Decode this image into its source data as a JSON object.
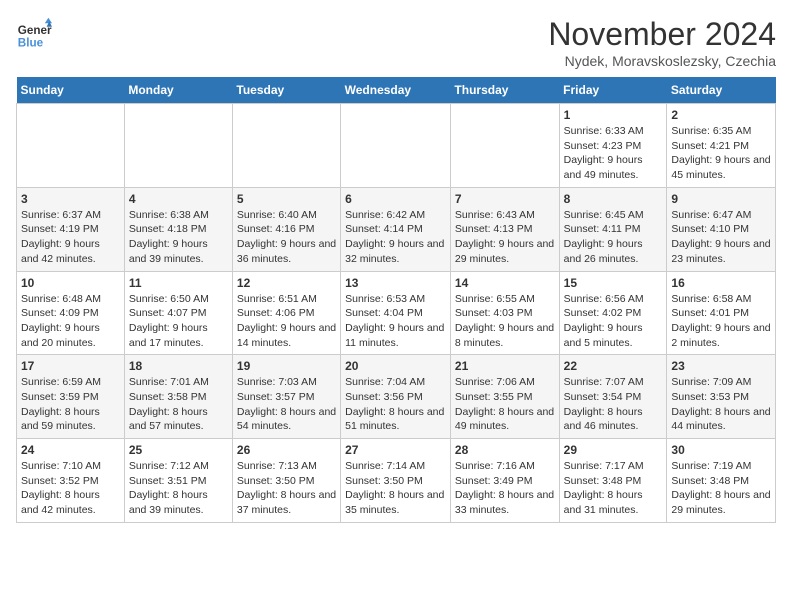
{
  "logo": {
    "line1": "General",
    "line2": "Blue"
  },
  "title": "November 2024",
  "subtitle": "Nydek, Moravskoslezsky, Czechia",
  "days_of_week": [
    "Sunday",
    "Monday",
    "Tuesday",
    "Wednesday",
    "Thursday",
    "Friday",
    "Saturday"
  ],
  "weeks": [
    [
      {
        "day": "",
        "info": ""
      },
      {
        "day": "",
        "info": ""
      },
      {
        "day": "",
        "info": ""
      },
      {
        "day": "",
        "info": ""
      },
      {
        "day": "",
        "info": ""
      },
      {
        "day": "1",
        "info": "Sunrise: 6:33 AM\nSunset: 4:23 PM\nDaylight: 9 hours and 49 minutes."
      },
      {
        "day": "2",
        "info": "Sunrise: 6:35 AM\nSunset: 4:21 PM\nDaylight: 9 hours and 45 minutes."
      }
    ],
    [
      {
        "day": "3",
        "info": "Sunrise: 6:37 AM\nSunset: 4:19 PM\nDaylight: 9 hours and 42 minutes."
      },
      {
        "day": "4",
        "info": "Sunrise: 6:38 AM\nSunset: 4:18 PM\nDaylight: 9 hours and 39 minutes."
      },
      {
        "day": "5",
        "info": "Sunrise: 6:40 AM\nSunset: 4:16 PM\nDaylight: 9 hours and 36 minutes."
      },
      {
        "day": "6",
        "info": "Sunrise: 6:42 AM\nSunset: 4:14 PM\nDaylight: 9 hours and 32 minutes."
      },
      {
        "day": "7",
        "info": "Sunrise: 6:43 AM\nSunset: 4:13 PM\nDaylight: 9 hours and 29 minutes."
      },
      {
        "day": "8",
        "info": "Sunrise: 6:45 AM\nSunset: 4:11 PM\nDaylight: 9 hours and 26 minutes."
      },
      {
        "day": "9",
        "info": "Sunrise: 6:47 AM\nSunset: 4:10 PM\nDaylight: 9 hours and 23 minutes."
      }
    ],
    [
      {
        "day": "10",
        "info": "Sunrise: 6:48 AM\nSunset: 4:09 PM\nDaylight: 9 hours and 20 minutes."
      },
      {
        "day": "11",
        "info": "Sunrise: 6:50 AM\nSunset: 4:07 PM\nDaylight: 9 hours and 17 minutes."
      },
      {
        "day": "12",
        "info": "Sunrise: 6:51 AM\nSunset: 4:06 PM\nDaylight: 9 hours and 14 minutes."
      },
      {
        "day": "13",
        "info": "Sunrise: 6:53 AM\nSunset: 4:04 PM\nDaylight: 9 hours and 11 minutes."
      },
      {
        "day": "14",
        "info": "Sunrise: 6:55 AM\nSunset: 4:03 PM\nDaylight: 9 hours and 8 minutes."
      },
      {
        "day": "15",
        "info": "Sunrise: 6:56 AM\nSunset: 4:02 PM\nDaylight: 9 hours and 5 minutes."
      },
      {
        "day": "16",
        "info": "Sunrise: 6:58 AM\nSunset: 4:01 PM\nDaylight: 9 hours and 2 minutes."
      }
    ],
    [
      {
        "day": "17",
        "info": "Sunrise: 6:59 AM\nSunset: 3:59 PM\nDaylight: 8 hours and 59 minutes."
      },
      {
        "day": "18",
        "info": "Sunrise: 7:01 AM\nSunset: 3:58 PM\nDaylight: 8 hours and 57 minutes."
      },
      {
        "day": "19",
        "info": "Sunrise: 7:03 AM\nSunset: 3:57 PM\nDaylight: 8 hours and 54 minutes."
      },
      {
        "day": "20",
        "info": "Sunrise: 7:04 AM\nSunset: 3:56 PM\nDaylight: 8 hours and 51 minutes."
      },
      {
        "day": "21",
        "info": "Sunrise: 7:06 AM\nSunset: 3:55 PM\nDaylight: 8 hours and 49 minutes."
      },
      {
        "day": "22",
        "info": "Sunrise: 7:07 AM\nSunset: 3:54 PM\nDaylight: 8 hours and 46 minutes."
      },
      {
        "day": "23",
        "info": "Sunrise: 7:09 AM\nSunset: 3:53 PM\nDaylight: 8 hours and 44 minutes."
      }
    ],
    [
      {
        "day": "24",
        "info": "Sunrise: 7:10 AM\nSunset: 3:52 PM\nDaylight: 8 hours and 42 minutes."
      },
      {
        "day": "25",
        "info": "Sunrise: 7:12 AM\nSunset: 3:51 PM\nDaylight: 8 hours and 39 minutes."
      },
      {
        "day": "26",
        "info": "Sunrise: 7:13 AM\nSunset: 3:50 PM\nDaylight: 8 hours and 37 minutes."
      },
      {
        "day": "27",
        "info": "Sunrise: 7:14 AM\nSunset: 3:50 PM\nDaylight: 8 hours and 35 minutes."
      },
      {
        "day": "28",
        "info": "Sunrise: 7:16 AM\nSunset: 3:49 PM\nDaylight: 8 hours and 33 minutes."
      },
      {
        "day": "29",
        "info": "Sunrise: 7:17 AM\nSunset: 3:48 PM\nDaylight: 8 hours and 31 minutes."
      },
      {
        "day": "30",
        "info": "Sunrise: 7:19 AM\nSunset: 3:48 PM\nDaylight: 8 hours and 29 minutes."
      }
    ]
  ]
}
